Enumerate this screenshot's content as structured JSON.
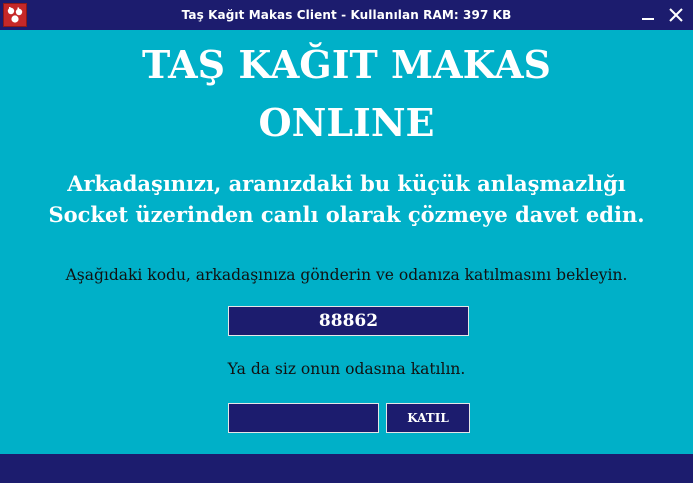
{
  "window": {
    "title": "Taş Kağıt Makas Client - Kullanılan RAM: 397 KB",
    "icon": "rock-paper-scissors-hands-icon",
    "controls": [
      "minimize-icon",
      "close-icon"
    ]
  },
  "main": {
    "title_line1": "TAŞ KAĞIT MAKAS",
    "title_line2": "ONLINE",
    "subtitle_line1": "Arkadaşınızı, aranızdaki bu küçük anlaşmazlığı",
    "subtitle_line2": "Socket üzerinden canlı olarak çözmeye davet edin.",
    "instruction_share": "Aşağıdaki kodu, arkadaşınıza gönderin ve odanıza katılmasını bekleyin.",
    "room_code": "88862",
    "instruction_join": "Ya da siz onun odasına katılın.",
    "join_input_value": "",
    "join_button_label": "KATIL"
  },
  "colors": {
    "background": "#00B0C8",
    "navy": "#1C1C6E",
    "icon_red": "#C62828",
    "heading_text": "#FFFFFF",
    "body_text": "#111111"
  }
}
